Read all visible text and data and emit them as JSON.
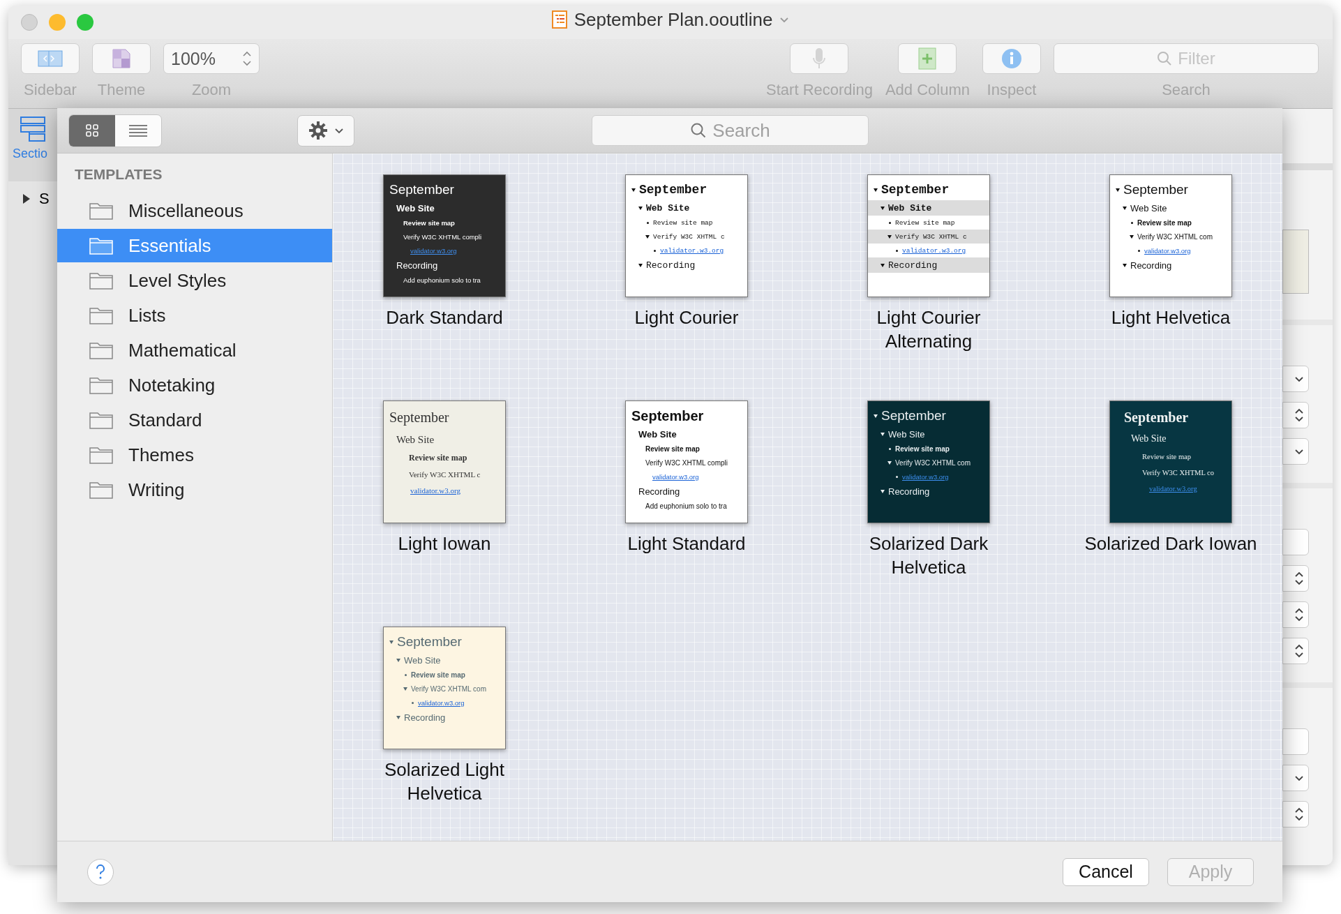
{
  "window": {
    "title": "September Plan.ooutline"
  },
  "toolbar": {
    "items": [
      {
        "kind": "sidebar",
        "label": "Sidebar"
      },
      {
        "kind": "theme",
        "label": "Theme"
      },
      {
        "kind": "zoom",
        "label": "Zoom",
        "value": "100%"
      },
      {
        "kind": "record",
        "label": "Start Recording"
      },
      {
        "kind": "column",
        "label": "Add Column"
      },
      {
        "kind": "inspect",
        "label": "Inspect"
      },
      {
        "kind": "search",
        "label": "Search",
        "placeholder": "Filter"
      }
    ]
  },
  "background_sidebar": {
    "tab_label": "Sectio",
    "row_text": "S"
  },
  "sheet": {
    "view_modes": [
      {
        "kind": "grid",
        "selected": true
      },
      {
        "kind": "list",
        "selected": false
      }
    ],
    "search": {
      "placeholder": "Search"
    },
    "sidebar": {
      "heading": "TEMPLATES",
      "items": [
        {
          "label": "Miscellaneous",
          "selected": false
        },
        {
          "label": "Essentials",
          "selected": true
        },
        {
          "label": "Level Styles",
          "selected": false
        },
        {
          "label": "Lists",
          "selected": false
        },
        {
          "label": "Mathematical",
          "selected": false
        },
        {
          "label": "Notetaking",
          "selected": false
        },
        {
          "label": "Standard",
          "selected": false
        },
        {
          "label": "Themes",
          "selected": false
        },
        {
          "label": "Writing",
          "selected": false
        }
      ]
    },
    "templates": [
      {
        "name": "Dark Standard",
        "outline": [
          {
            "text": "September",
            "kind": "plain",
            "children": [
              {
                "text": "Web Site",
                "kind": "bold",
                "children": [
                  {
                    "text": "Review site map",
                    "kind": "bold"
                  },
                  {
                    "text": "Verify W3C XHTML compli",
                    "kind": "plain",
                    "children": [
                      {
                        "text": "validator.w3.org",
                        "kind": "link"
                      }
                    ]
                  }
                ]
              },
              {
                "text": "Recording",
                "kind": "plain",
                "children": [
                  {
                    "text": "Add euphonium solo to tra",
                    "kind": "plain"
                  }
                ]
              }
            ]
          }
        ]
      },
      {
        "name": "Light Courier",
        "outline": [
          {
            "text": "September",
            "kind": "bold",
            "children": [
              {
                "text": "Web Site",
                "kind": "bold",
                "children": [
                  {
                    "text": "Review site map",
                    "kind": "plain"
                  },
                  {
                    "text": "Verify W3C XHTML c",
                    "kind": "plain",
                    "children": [
                      {
                        "text": "validator.w3.org",
                        "kind": "link"
                      }
                    ]
                  }
                ]
              },
              {
                "text": "Recording",
                "kind": "plain"
              }
            ]
          }
        ]
      },
      {
        "name": "Light Courier Alternating",
        "outline": [
          {
            "text": "September",
            "kind": "bold",
            "children": [
              {
                "text": "Web Site",
                "kind": "bold",
                "children": [
                  {
                    "text": "Review site map",
                    "kind": "plain"
                  },
                  {
                    "text": "Verify W3C XHTML c",
                    "kind": "plain",
                    "children": [
                      {
                        "text": "validator.w3.org",
                        "kind": "link"
                      }
                    ]
                  }
                ]
              },
              {
                "text": "Recording",
                "kind": "plain"
              }
            ]
          }
        ]
      },
      {
        "name": "Light Helvetica",
        "outline": [
          {
            "text": "September",
            "kind": "plain",
            "children": [
              {
                "text": "Web Site",
                "kind": "plain",
                "children": [
                  {
                    "text": "Review site map",
                    "kind": "bold"
                  },
                  {
                    "text": "Verify W3C XHTML com",
                    "kind": "plain",
                    "children": [
                      {
                        "text": "validator.w3.org",
                        "kind": "link"
                      }
                    ]
                  }
                ]
              },
              {
                "text": "Recording",
                "kind": "plain"
              }
            ]
          }
        ]
      },
      {
        "name": "Light Iowan",
        "outline": [
          {
            "text": "September",
            "kind": "plain",
            "children": [
              {
                "text": "Web Site",
                "kind": "plain",
                "children": [
                  {
                    "text": "Review site map",
                    "kind": "bold"
                  },
                  {
                    "text": "Verify W3C XHTML c",
                    "kind": "plain",
                    "children": [
                      {
                        "text": "validator.w3.org",
                        "kind": "link"
                      }
                    ]
                  }
                ]
              }
            ]
          }
        ]
      },
      {
        "name": "Light Standard",
        "outline": [
          {
            "text": "September",
            "kind": "bold",
            "children": [
              {
                "text": "Web Site",
                "kind": "bold",
                "children": [
                  {
                    "text": "Review site map",
                    "kind": "bold"
                  },
                  {
                    "text": "Verify W3C XHTML compli",
                    "kind": "plain",
                    "children": [
                      {
                        "text": "validator.w3.org",
                        "kind": "link"
                      }
                    ]
                  }
                ]
              },
              {
                "text": "Recording",
                "kind": "plain",
                "children": [
                  {
                    "text": "Add euphonium solo to tra",
                    "kind": "plain"
                  }
                ]
              }
            ]
          }
        ]
      },
      {
        "name": "Solarized Dark Helvetica",
        "outline": [
          {
            "text": "September",
            "kind": "plain",
            "children": [
              {
                "text": "Web Site",
                "kind": "plain",
                "children": [
                  {
                    "text": "Review site map",
                    "kind": "bold"
                  },
                  {
                    "text": "Verify W3C XHTML com",
                    "kind": "plain",
                    "children": [
                      {
                        "text": "validator.w3.org",
                        "kind": "link"
                      }
                    ]
                  }
                ]
              },
              {
                "text": "Recording",
                "kind": "plain"
              }
            ]
          }
        ]
      },
      {
        "name": "Solarized Dark Iowan",
        "outline": [
          {
            "text": "September",
            "kind": "bold",
            "children": [
              {
                "text": "Web Site",
                "kind": "plain",
                "children": [
                  {
                    "text": "Review site map",
                    "kind": "plain"
                  },
                  {
                    "text": "Verify W3C XHTML co",
                    "kind": "plain",
                    "children": [
                      {
                        "text": "validator.w3.org",
                        "kind": "link"
                      }
                    ]
                  }
                ]
              }
            ]
          }
        ]
      },
      {
        "name": "Solarized Light Helvetica",
        "outline": [
          {
            "text": "September",
            "kind": "plain",
            "children": [
              {
                "text": "Web Site",
                "kind": "plain",
                "children": [
                  {
                    "text": "Review site map",
                    "kind": "bold"
                  },
                  {
                    "text": "Verify W3C XHTML com",
                    "kind": "plain",
                    "children": [
                      {
                        "text": "validator.w3.org",
                        "kind": "link"
                      }
                    ]
                  }
                ]
              },
              {
                "text": "Recording",
                "kind": "plain"
              }
            ]
          }
        ]
      }
    ],
    "buttons": [
      {
        "label": "Cancel",
        "disabled": false
      },
      {
        "label": "Apply",
        "disabled": true
      }
    ]
  }
}
